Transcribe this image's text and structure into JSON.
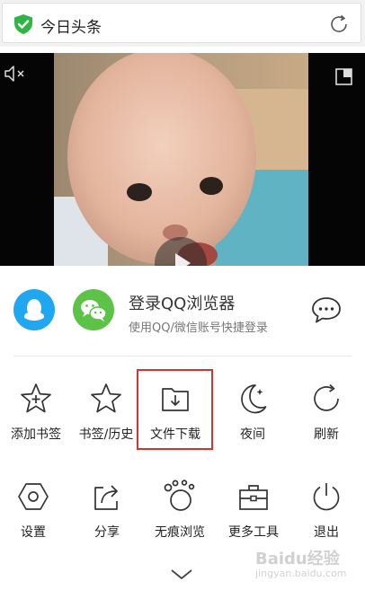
{
  "address_bar": {
    "title": "今日头条"
  },
  "login": {
    "title": "登录QQ浏览器",
    "subtitle": "使用QQ/微信账号快捷登录"
  },
  "menu_rows": [
    [
      {
        "label": "添加书签",
        "icon": "add-bookmark-icon"
      },
      {
        "label": "书签/历史",
        "icon": "bookmark-history-icon"
      },
      {
        "label": "文件下载",
        "icon": "file-download-icon"
      },
      {
        "label": "夜间",
        "icon": "night-mode-icon"
      },
      {
        "label": "刷新",
        "icon": "refresh-icon"
      }
    ],
    [
      {
        "label": "设置",
        "icon": "settings-icon"
      },
      {
        "label": "分享",
        "icon": "share-icon"
      },
      {
        "label": "无痕浏览",
        "icon": "incognito-icon"
      },
      {
        "label": "更多工具",
        "icon": "toolbox-icon"
      },
      {
        "label": "退出",
        "icon": "power-icon"
      }
    ]
  ],
  "watermark": {
    "text": "Baidu经验",
    "sub": "jingyan.baidu.com"
  },
  "colors": {
    "qq_blue": "#21a7f0",
    "wechat_green": "#5cc346",
    "highlight_red": "#d73232",
    "shield_green": "#2fb544"
  }
}
